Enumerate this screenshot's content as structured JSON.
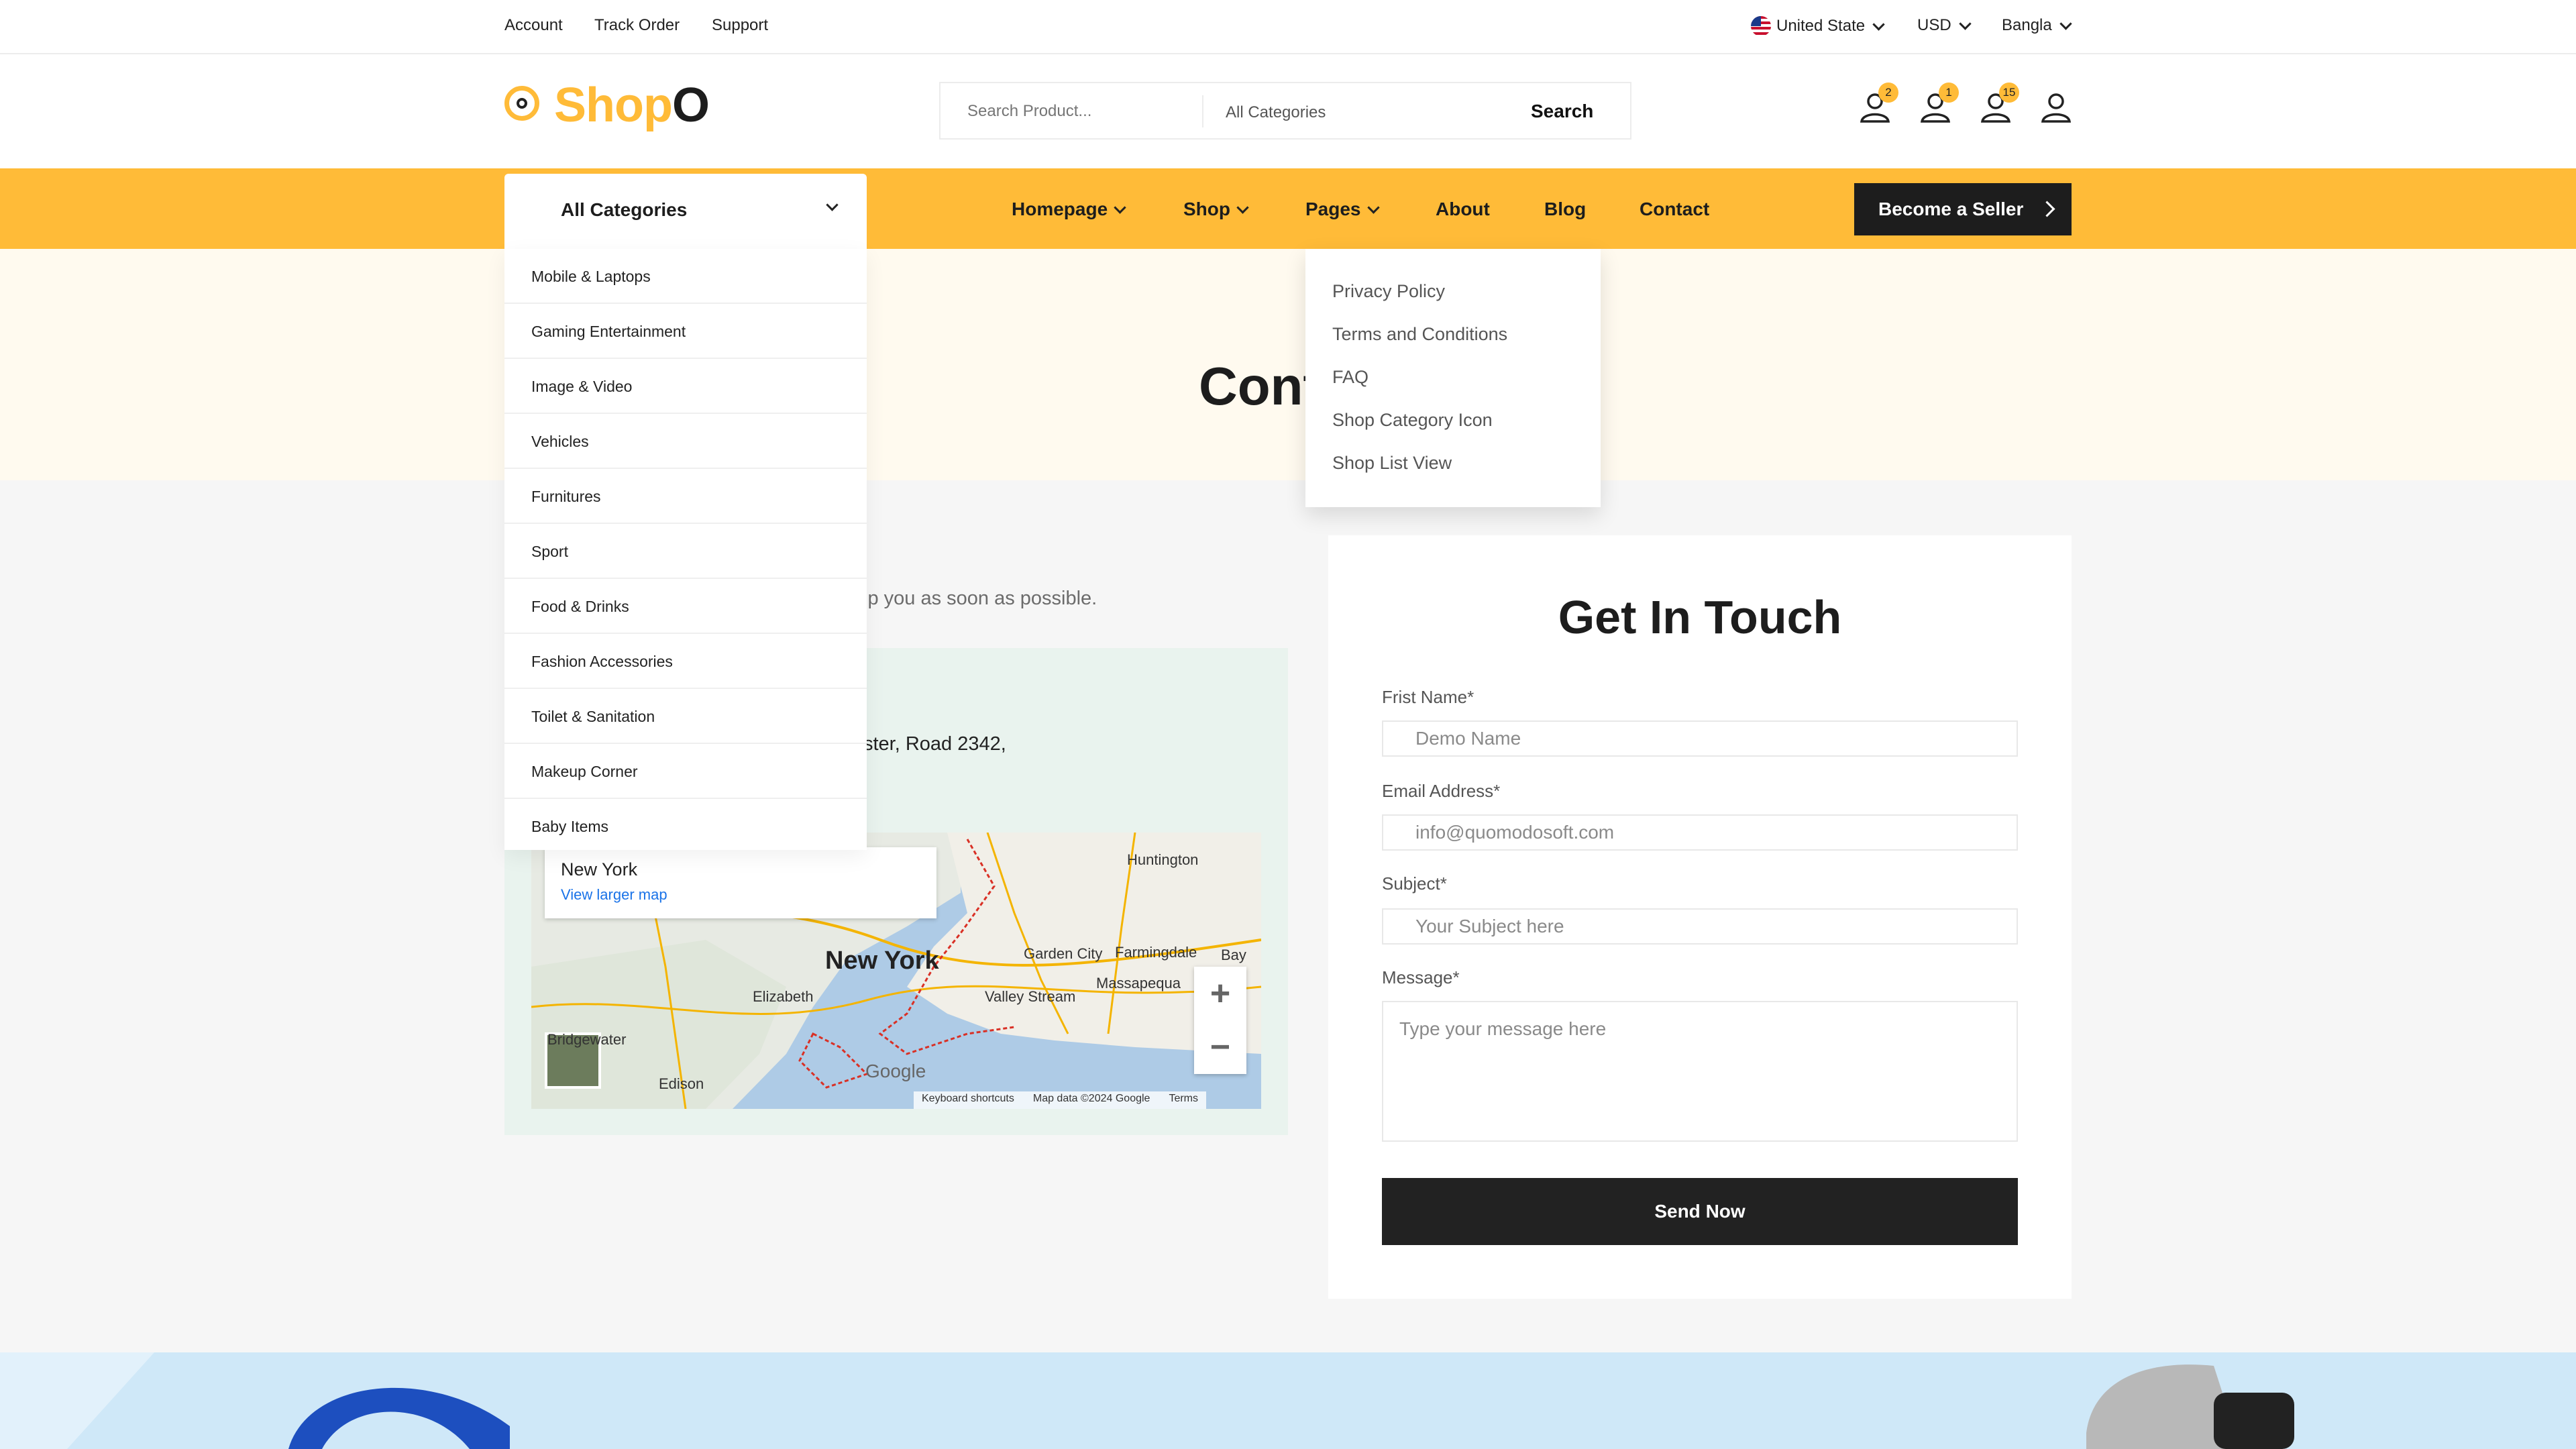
{
  "topbar": {
    "links": [
      "Account",
      "Track Order",
      "Support"
    ],
    "country": "United State",
    "currency": "USD",
    "language": "Bangla"
  },
  "header": {
    "logo_main": "Shop",
    "logo_accent": "O",
    "search_placeholder": "Search Product...",
    "search_category": "All Categories",
    "search_button": "Search",
    "badges": [
      "2",
      "1",
      "15"
    ]
  },
  "nav": {
    "all_categories": "All Categories",
    "items": [
      "Homepage",
      "Shop",
      "Pages",
      "About",
      "Blog",
      "Contact"
    ],
    "seller_button": "Become a Seller"
  },
  "categories": [
    "Mobile & Laptops",
    "Gaming Entertainment",
    "Image & Video",
    "Vehicles",
    "Furnitures",
    "Sport",
    "Food & Drinks",
    "Fashion Accessories",
    "Toilet & Sanitation",
    "Makeup Corner",
    "Baby Items"
  ],
  "pages_menu": [
    "Privacy Policy",
    "Terms and Conditions",
    "FAQ",
    "Shop Category Icon",
    "Shop List View"
  ],
  "hero": {
    "title": "Cont"
  },
  "contact": {
    "lead": "lp you as soon as possible.",
    "address": "ster, Road 2342,"
  },
  "map": {
    "card_title": "New York",
    "card_link": "View larger map",
    "places": [
      "Huntington",
      "New York",
      "Garden City",
      "Farmingdale",
      "Bay Sh",
      "Elizabeth",
      "Valley Stream",
      "Massapequa",
      "Bridgewater",
      "Edison"
    ],
    "attribution": [
      "Keyboard shortcuts",
      "Map data ©2024 Google",
      "Terms"
    ],
    "google": "Google"
  },
  "form": {
    "title": "Get In Touch",
    "first_name_label": "Frist Name*",
    "first_name_placeholder": "Demo Name",
    "email_label": "Email Address*",
    "email_placeholder": "info@quomodosoft.com",
    "subject_label": "Subject*",
    "subject_placeholder": "Your Subject here",
    "message_label": "Message*",
    "message_placeholder": "Type your message here",
    "send_button": "Send Now"
  },
  "colors": {
    "accent": "#ffbb38",
    "dark": "#1d1d1d",
    "hero_bg": "#fffaef",
    "banner_bg": "#cfe8f8"
  }
}
